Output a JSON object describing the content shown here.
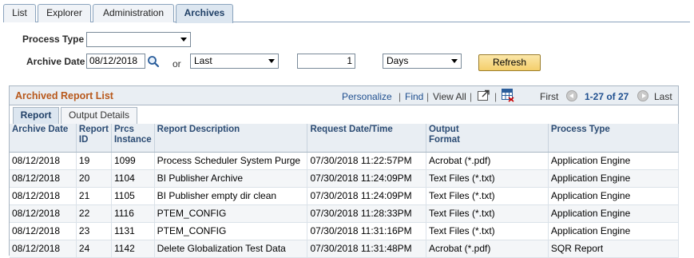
{
  "tabs": [
    {
      "label": "List",
      "active": false
    },
    {
      "label": "Explorer",
      "active": false
    },
    {
      "label": "Administration",
      "active": false
    },
    {
      "label": "Archives",
      "active": true
    }
  ],
  "criteria": {
    "process_type_label": "Process Type",
    "process_type_value": "",
    "archive_date_label": "Archive Date",
    "archive_date_value": "08/12/2018",
    "or_label": "or",
    "range_select": "Last",
    "range_number": "1",
    "unit_select": "Days",
    "refresh_label": "Refresh"
  },
  "grid": {
    "title": "Archived Report List",
    "personalize": "Personalize",
    "find": "Find",
    "view_all": "View All",
    "first": "First",
    "range": "1-27 of 27",
    "last": "Last",
    "subtabs": [
      "Report",
      "Output Details"
    ],
    "columns": [
      [
        "Archive Date"
      ],
      [
        "Report",
        "ID"
      ],
      [
        "Prcs",
        "Instance"
      ],
      [
        "Report Description"
      ],
      [
        "Request Date/Time"
      ],
      [
        "Output",
        "Format"
      ],
      [
        "Process Type"
      ]
    ],
    "rows": [
      [
        "08/12/2018",
        "19",
        "1099",
        "Process Scheduler System Purge",
        "07/30/2018 11:22:57PM",
        "Acrobat (*.pdf)",
        "Application Engine"
      ],
      [
        "08/12/2018",
        "20",
        "1104",
        "BI Publisher Archive",
        "07/30/2018 11:24:09PM",
        "Text Files (*.txt)",
        "Application Engine"
      ],
      [
        "08/12/2018",
        "21",
        "1105",
        "BI Publisher empty dir clean",
        "07/30/2018 11:24:09PM",
        "Text Files (*.txt)",
        "Application Engine"
      ],
      [
        "08/12/2018",
        "22",
        "1116",
        "PTEM_CONFIG",
        "07/30/2018 11:28:33PM",
        "Text Files (*.txt)",
        "Application Engine"
      ],
      [
        "08/12/2018",
        "23",
        "1131",
        "PTEM_CONFIG",
        "07/30/2018 11:31:16PM",
        "Text Files (*.txt)",
        "Application Engine"
      ],
      [
        "08/12/2018",
        "24",
        "1142",
        "Delete Globalization Test Data",
        "07/30/2018 11:31:48PM",
        "Acrobat (*.pdf)",
        "SQR Report"
      ]
    ]
  }
}
